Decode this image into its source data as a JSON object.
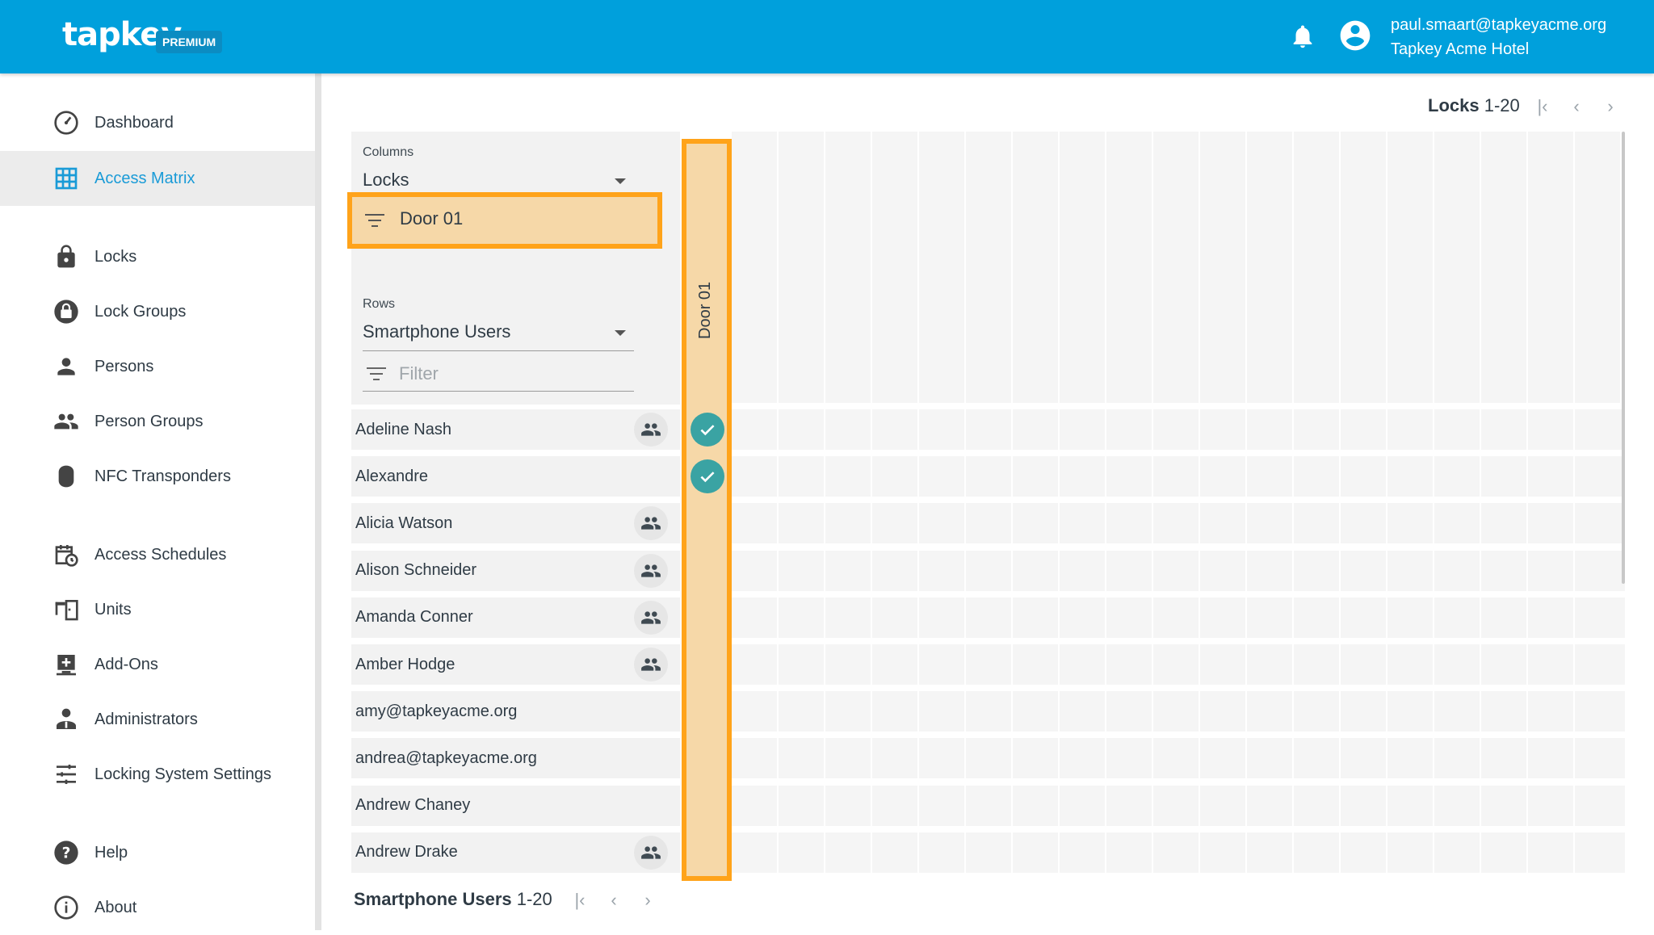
{
  "header": {
    "logo": "tapkey",
    "badge": "PREMIUM",
    "user_email": "paul.smaart@tapkeyacme.org",
    "user_org": "Tapkey Acme Hotel",
    "icons": [
      "bell-icon",
      "account-icon"
    ]
  },
  "sidebar": {
    "items": [
      {
        "label": "Dashboard",
        "icon": "dashboard-icon",
        "active": false
      },
      {
        "label": "Access Matrix",
        "icon": "grid-icon",
        "active": true
      },
      {
        "label": "Locks",
        "icon": "lock-icon",
        "active": false
      },
      {
        "label": "Lock Groups",
        "icon": "lock-group-icon",
        "active": false
      },
      {
        "label": "Persons",
        "icon": "person-icon",
        "active": false
      },
      {
        "label": "Person Groups",
        "icon": "people-icon",
        "active": false
      },
      {
        "label": "NFC Transponders",
        "icon": "transponder-icon",
        "active": false
      },
      {
        "label": "Access Schedules",
        "icon": "schedule-icon",
        "active": false
      },
      {
        "label": "Units",
        "icon": "units-icon",
        "active": false
      },
      {
        "label": "Add-Ons",
        "icon": "addons-icon",
        "active": false
      },
      {
        "label": "Administrators",
        "icon": "admin-icon",
        "active": false
      },
      {
        "label": "Locking System Settings",
        "icon": "settings-sliders-icon",
        "active": false
      },
      {
        "label": "Help",
        "icon": "help-icon",
        "active": false
      },
      {
        "label": "About",
        "icon": "info-icon",
        "active": false
      }
    ]
  },
  "paging_top": {
    "label": "Locks",
    "range": "1-20"
  },
  "columns": {
    "label": "Columns",
    "selected": "Locks",
    "filter_value": "Door 01"
  },
  "rows": {
    "label": "Rows",
    "selected": "Smartphone Users",
    "filter_placeholder": "Filter"
  },
  "column_header": "Door 01",
  "users": [
    {
      "name": "Adeline Nash",
      "group": true,
      "access": true
    },
    {
      "name": "Alexandre",
      "group": false,
      "access": true
    },
    {
      "name": "Alicia Watson",
      "group": true,
      "access": false
    },
    {
      "name": "Alison Schneider",
      "group": true,
      "access": false
    },
    {
      "name": "Amanda Conner",
      "group": true,
      "access": false
    },
    {
      "name": "Amber Hodge",
      "group": true,
      "access": false
    },
    {
      "name": "amy@tapkeyacme.org",
      "group": false,
      "access": false
    },
    {
      "name": "andrea@tapkeyacme.org",
      "group": false,
      "access": false
    },
    {
      "name": "Andrew Chaney",
      "group": false,
      "access": false
    },
    {
      "name": "Andrew Drake",
      "group": true,
      "access": false
    }
  ],
  "paging_bottom": {
    "label": "Smartphone Users",
    "range": "1-20"
  },
  "colors": {
    "header": "#00a0dc",
    "active": "#1a9bd7",
    "highlight": "#ffa31a",
    "check": "#3aa3a3"
  }
}
